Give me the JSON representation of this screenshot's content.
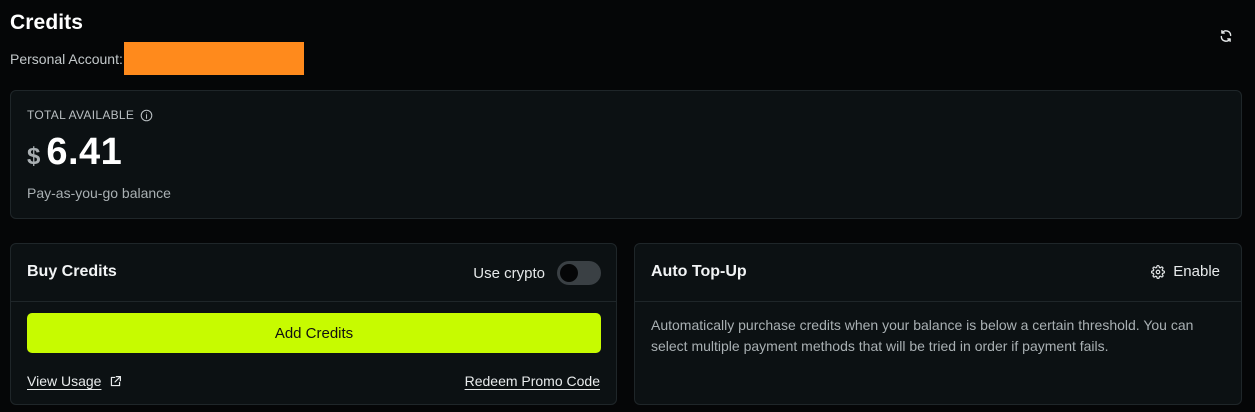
{
  "header": {
    "title": "Credits",
    "account_label": "Personal Account:",
    "refresh_icon": "refresh-icon"
  },
  "balance": {
    "label": "TOTAL AVAILABLE",
    "info_icon": "info-icon",
    "currency_symbol": "$",
    "amount": "6.41",
    "subtitle": "Pay-as-you-go balance"
  },
  "buy_credits": {
    "title": "Buy Credits",
    "crypto_label": "Use crypto",
    "crypto_enabled": false,
    "add_button_label": "Add Credits",
    "view_usage_label": "View Usage",
    "external_icon": "external-link-icon",
    "redeem_label": "Redeem Promo Code"
  },
  "auto_topup": {
    "title": "Auto Top-Up",
    "enable_label": "Enable",
    "gear_icon": "gear-icon",
    "description": "Automatically purchase credits when your balance is below a certain threshold. You can select multiple payment methods that will be tried in order if payment fails."
  },
  "colors": {
    "background": "#050607",
    "card": "#0c1113",
    "accent": "#c7fb00",
    "redaction": "#ff8a1c"
  }
}
